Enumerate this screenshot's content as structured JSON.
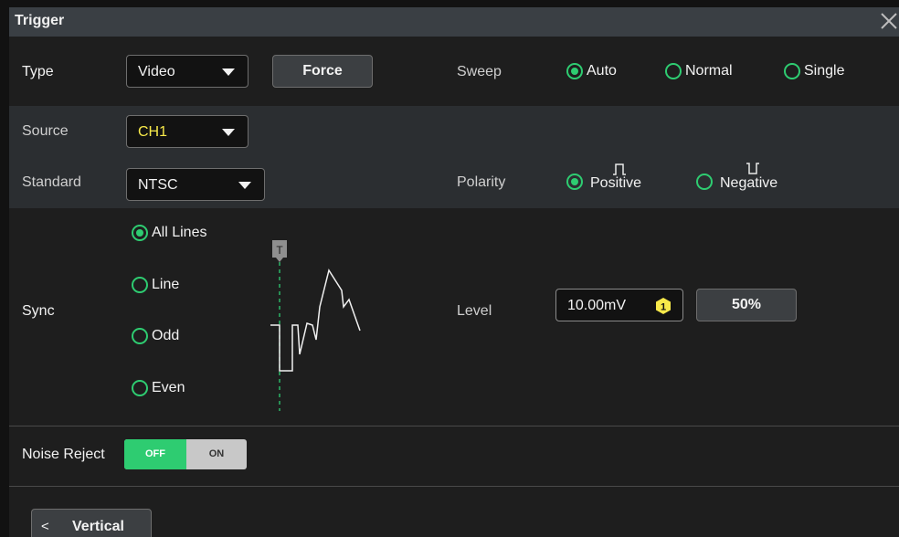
{
  "window": {
    "title": "Trigger",
    "close_icon": "close-icon"
  },
  "type": {
    "label": "Type",
    "value": "Video",
    "force_label": "Force"
  },
  "sweep": {
    "label": "Sweep",
    "options": [
      {
        "label": "Auto",
        "selected": true
      },
      {
        "label": "Normal",
        "selected": false
      },
      {
        "label": "Single",
        "selected": false
      }
    ]
  },
  "source": {
    "label": "Source",
    "value": "CH1",
    "value_color": "#f7e94a"
  },
  "standard": {
    "label": "Standard",
    "value": "NTSC"
  },
  "polarity": {
    "label": "Polarity",
    "options": [
      {
        "label": "Positive",
        "selected": true,
        "icon": "positive-pulse-icon"
      },
      {
        "label": "Negative",
        "selected": false,
        "icon": "negative-pulse-icon"
      }
    ]
  },
  "sync": {
    "label": "Sync",
    "options": [
      {
        "label": "All Lines",
        "selected": true
      },
      {
        "label": "Line",
        "selected": false
      },
      {
        "label": "Odd",
        "selected": false
      },
      {
        "label": "Even",
        "selected": false
      }
    ],
    "trigger_marker": "T"
  },
  "level": {
    "label": "Level",
    "value": "10.00mV",
    "channel_badge": "1",
    "percent_label": "50%"
  },
  "noise_reject": {
    "label": "Noise Reject",
    "off_label": "OFF",
    "on_label": "ON",
    "state": "OFF"
  },
  "nav": {
    "back_chevron": "<",
    "label": "Vertical"
  },
  "colors": {
    "accent": "#2ecc71",
    "channel1": "#f7e94a",
    "title_bar": "#3a3f44",
    "panel": "#1e1e1e"
  }
}
